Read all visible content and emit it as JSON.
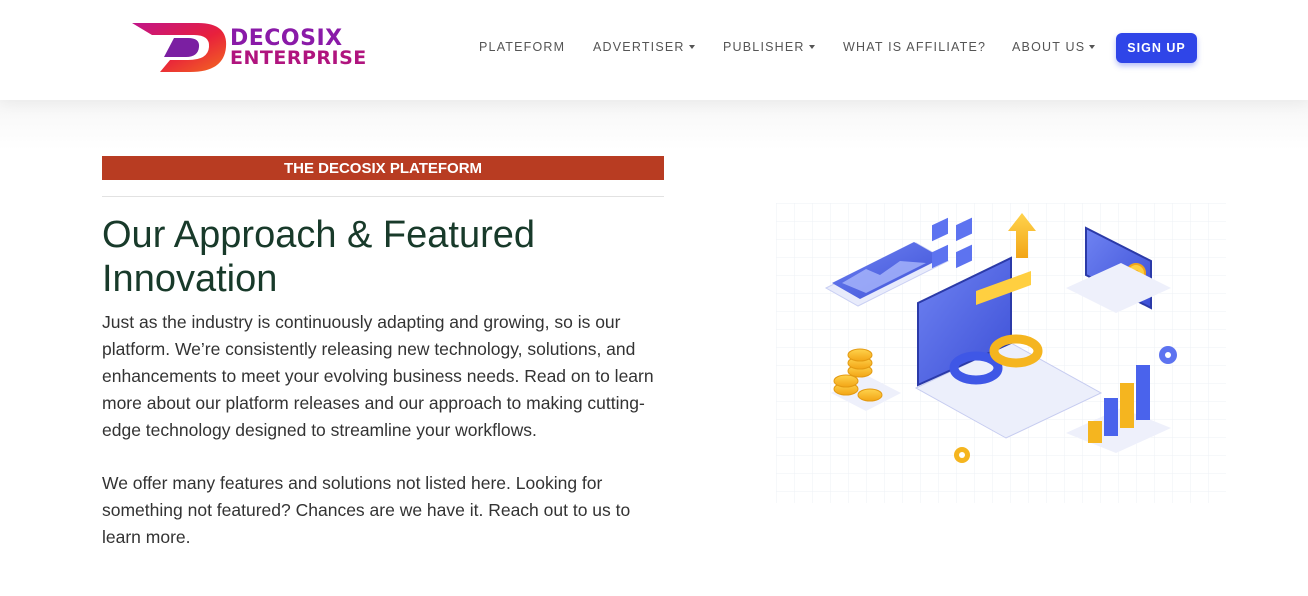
{
  "brand": {
    "line1": "DECOSIX",
    "line2": "ENTERPRISE",
    "colors": {
      "purple": "#8a1aa8",
      "magenta": "#b0147e",
      "red": "#e8203c"
    }
  },
  "nav": {
    "items": [
      {
        "label": "PLATEFORM"
      },
      {
        "label": "ADVERTISER"
      },
      {
        "label": "PUBLISHER"
      },
      {
        "label": "WHAT IS AFFILIATE?"
      },
      {
        "label": "ABOUT US"
      }
    ],
    "signup_label": "SIGN UP"
  },
  "main": {
    "badge": "THE DECOSIX PLATEFORM",
    "heading": "Our Approach & Featured Innovation",
    "paragraph1": "Just as the industry is continuously adapting and growing, so is our platform. We’re consistently releasing new technology, solutions, and enhancements to meet your evolving business needs.  Read on to learn more about our platform releases and our approach to making cutting-edge technology designed to streamline your workflows.",
    "paragraph2": "We offer many features and solutions not listed here. Looking for something not featured? Chances are we have it. Reach out to us to learn more."
  },
  "colors": {
    "accent_blue": "#2f45e8",
    "badge_red": "#b83c22",
    "heading_green": "#183a2a"
  }
}
